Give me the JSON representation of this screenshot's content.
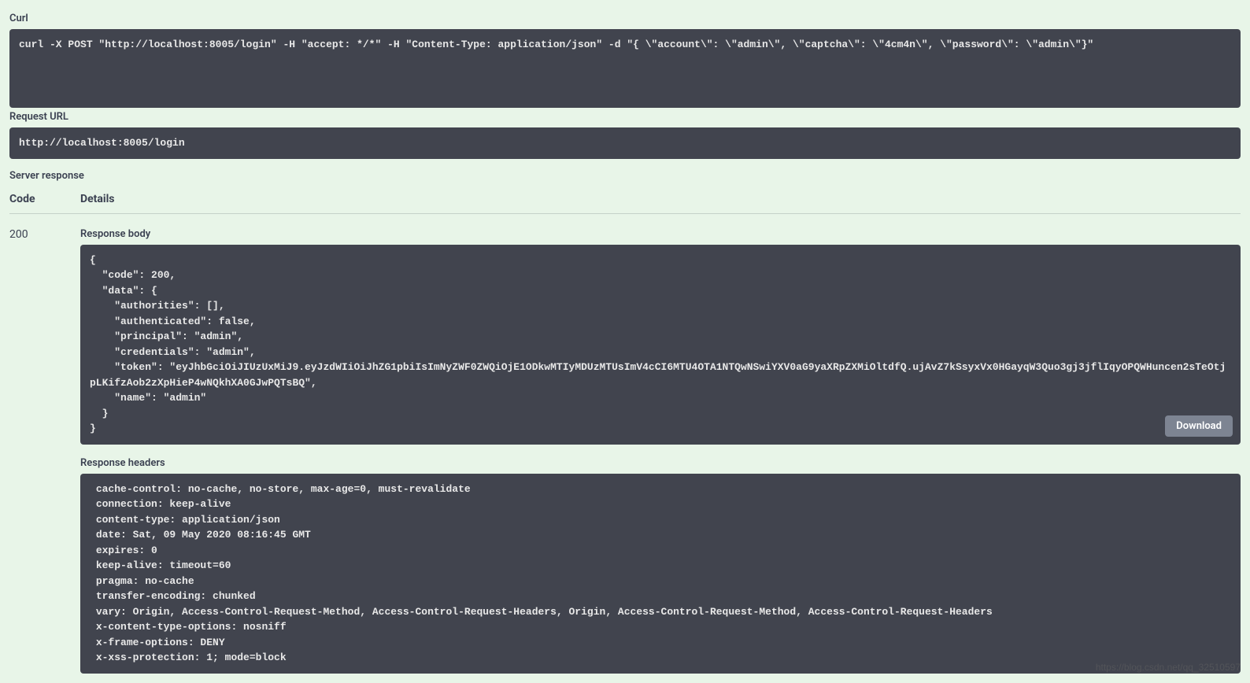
{
  "sections": {
    "curl_label": "Curl",
    "curl_content": "curl -X POST \"http://localhost:8005/login\" -H \"accept: */*\" -H \"Content-Type: application/json\" -d \"{ \\\"account\\\": \\\"admin\\\", \\\"captcha\\\": \\\"4cm4n\\\", \\\"password\\\": \\\"admin\\\"}\"",
    "request_url_label": "Request URL",
    "request_url_content": "http://localhost:8005/login",
    "server_response_label": "Server response"
  },
  "table": {
    "header_code": "Code",
    "header_details": "Details",
    "code_value": "200",
    "response_body_label": "Response body",
    "response_body_content": "{\n  \"code\": 200,\n  \"data\": {\n    \"authorities\": [],\n    \"authenticated\": false,\n    \"principal\": \"admin\",\n    \"credentials\": \"admin\",\n    \"token\": \"eyJhbGciOiJIUzUxMiJ9.eyJzdWIiOiJhZG1pbiIsImNyZWF0ZWQiOjE1ODkwMTIyMDUzMTUsImV4cCI6MTU4OTA1NTQwNSwiYXV0aG9yaXRpZXMiOltdfQ.ujAvZ7kSsyxVx0HGayqW3Quo3gj3jflIqyOPQWHuncen2sTeOtjpLKifzAob2zXpHieP4wNQkhXA0GJwPQTsBQ\",\n    \"name\": \"admin\"\n  }\n}",
    "download_label": "Download",
    "response_headers_label": "Response headers",
    "response_headers_content": " cache-control: no-cache, no-store, max-age=0, must-revalidate \n connection: keep-alive \n content-type: application/json \n date: Sat, 09 May 2020 08:16:45 GMT \n expires: 0 \n keep-alive: timeout=60 \n pragma: no-cache \n transfer-encoding: chunked \n vary: Origin, Access-Control-Request-Method, Access-Control-Request-Headers, Origin, Access-Control-Request-Method, Access-Control-Request-Headers \n x-content-type-options: nosniff \n x-frame-options: DENY \n x-xss-protection: 1; mode=block "
  },
  "watermark": "https://blog.csdn.net/qq_32510597"
}
